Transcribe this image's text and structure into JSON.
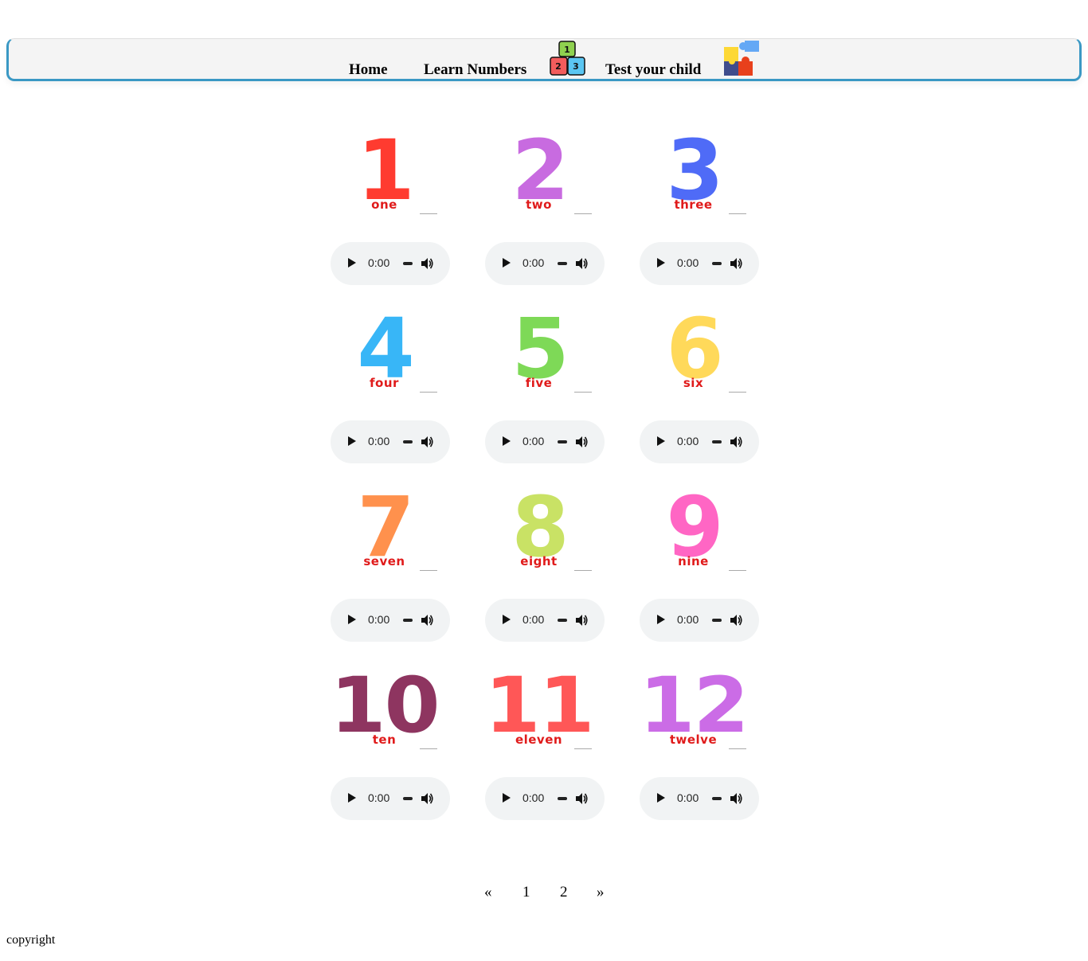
{
  "nav": {
    "home": "Home",
    "learn": "Learn Numbers",
    "test": "Test your child",
    "blocks_icon": {
      "digits": [
        "1",
        "2",
        "3"
      ],
      "colors": [
        "#8fd14f",
        "#f25c5c",
        "#5bc6f2"
      ]
    }
  },
  "cards": [
    {
      "numeral": "1",
      "word": "one",
      "color": "#ff3b30",
      "time": "0:00"
    },
    {
      "numeral": "2",
      "word": "two",
      "color": "#c86be0",
      "time": "0:00"
    },
    {
      "numeral": "3",
      "word": "three",
      "color": "#4f6bf7",
      "time": "0:00"
    },
    {
      "numeral": "4",
      "word": "four",
      "color": "#38b6f7",
      "time": "0:00"
    },
    {
      "numeral": "5",
      "word": "five",
      "color": "#7ed957",
      "time": "0:00"
    },
    {
      "numeral": "6",
      "word": "six",
      "color": "#ffd95a",
      "time": "0:00"
    },
    {
      "numeral": "7",
      "word": "seven",
      "color": "#ff914d",
      "time": "0:00"
    },
    {
      "numeral": "8",
      "word": "eight",
      "color": "#c9e265",
      "time": "0:00"
    },
    {
      "numeral": "9",
      "word": "nine",
      "color": "#ff66c4",
      "time": "0:00"
    },
    {
      "numeral": "10",
      "word": "ten",
      "color": "#8e3560",
      "time": "0:00"
    },
    {
      "numeral": "11",
      "word": "eleven",
      "color": "#ff5757",
      "time": "0:00"
    },
    {
      "numeral": "12",
      "word": "twelve",
      "color": "#cb6ce6",
      "time": "0:00"
    }
  ],
  "pagination": {
    "prev": "«",
    "pages": [
      "1",
      "2"
    ],
    "next": "»"
  },
  "footer": {
    "text": "copyright"
  }
}
